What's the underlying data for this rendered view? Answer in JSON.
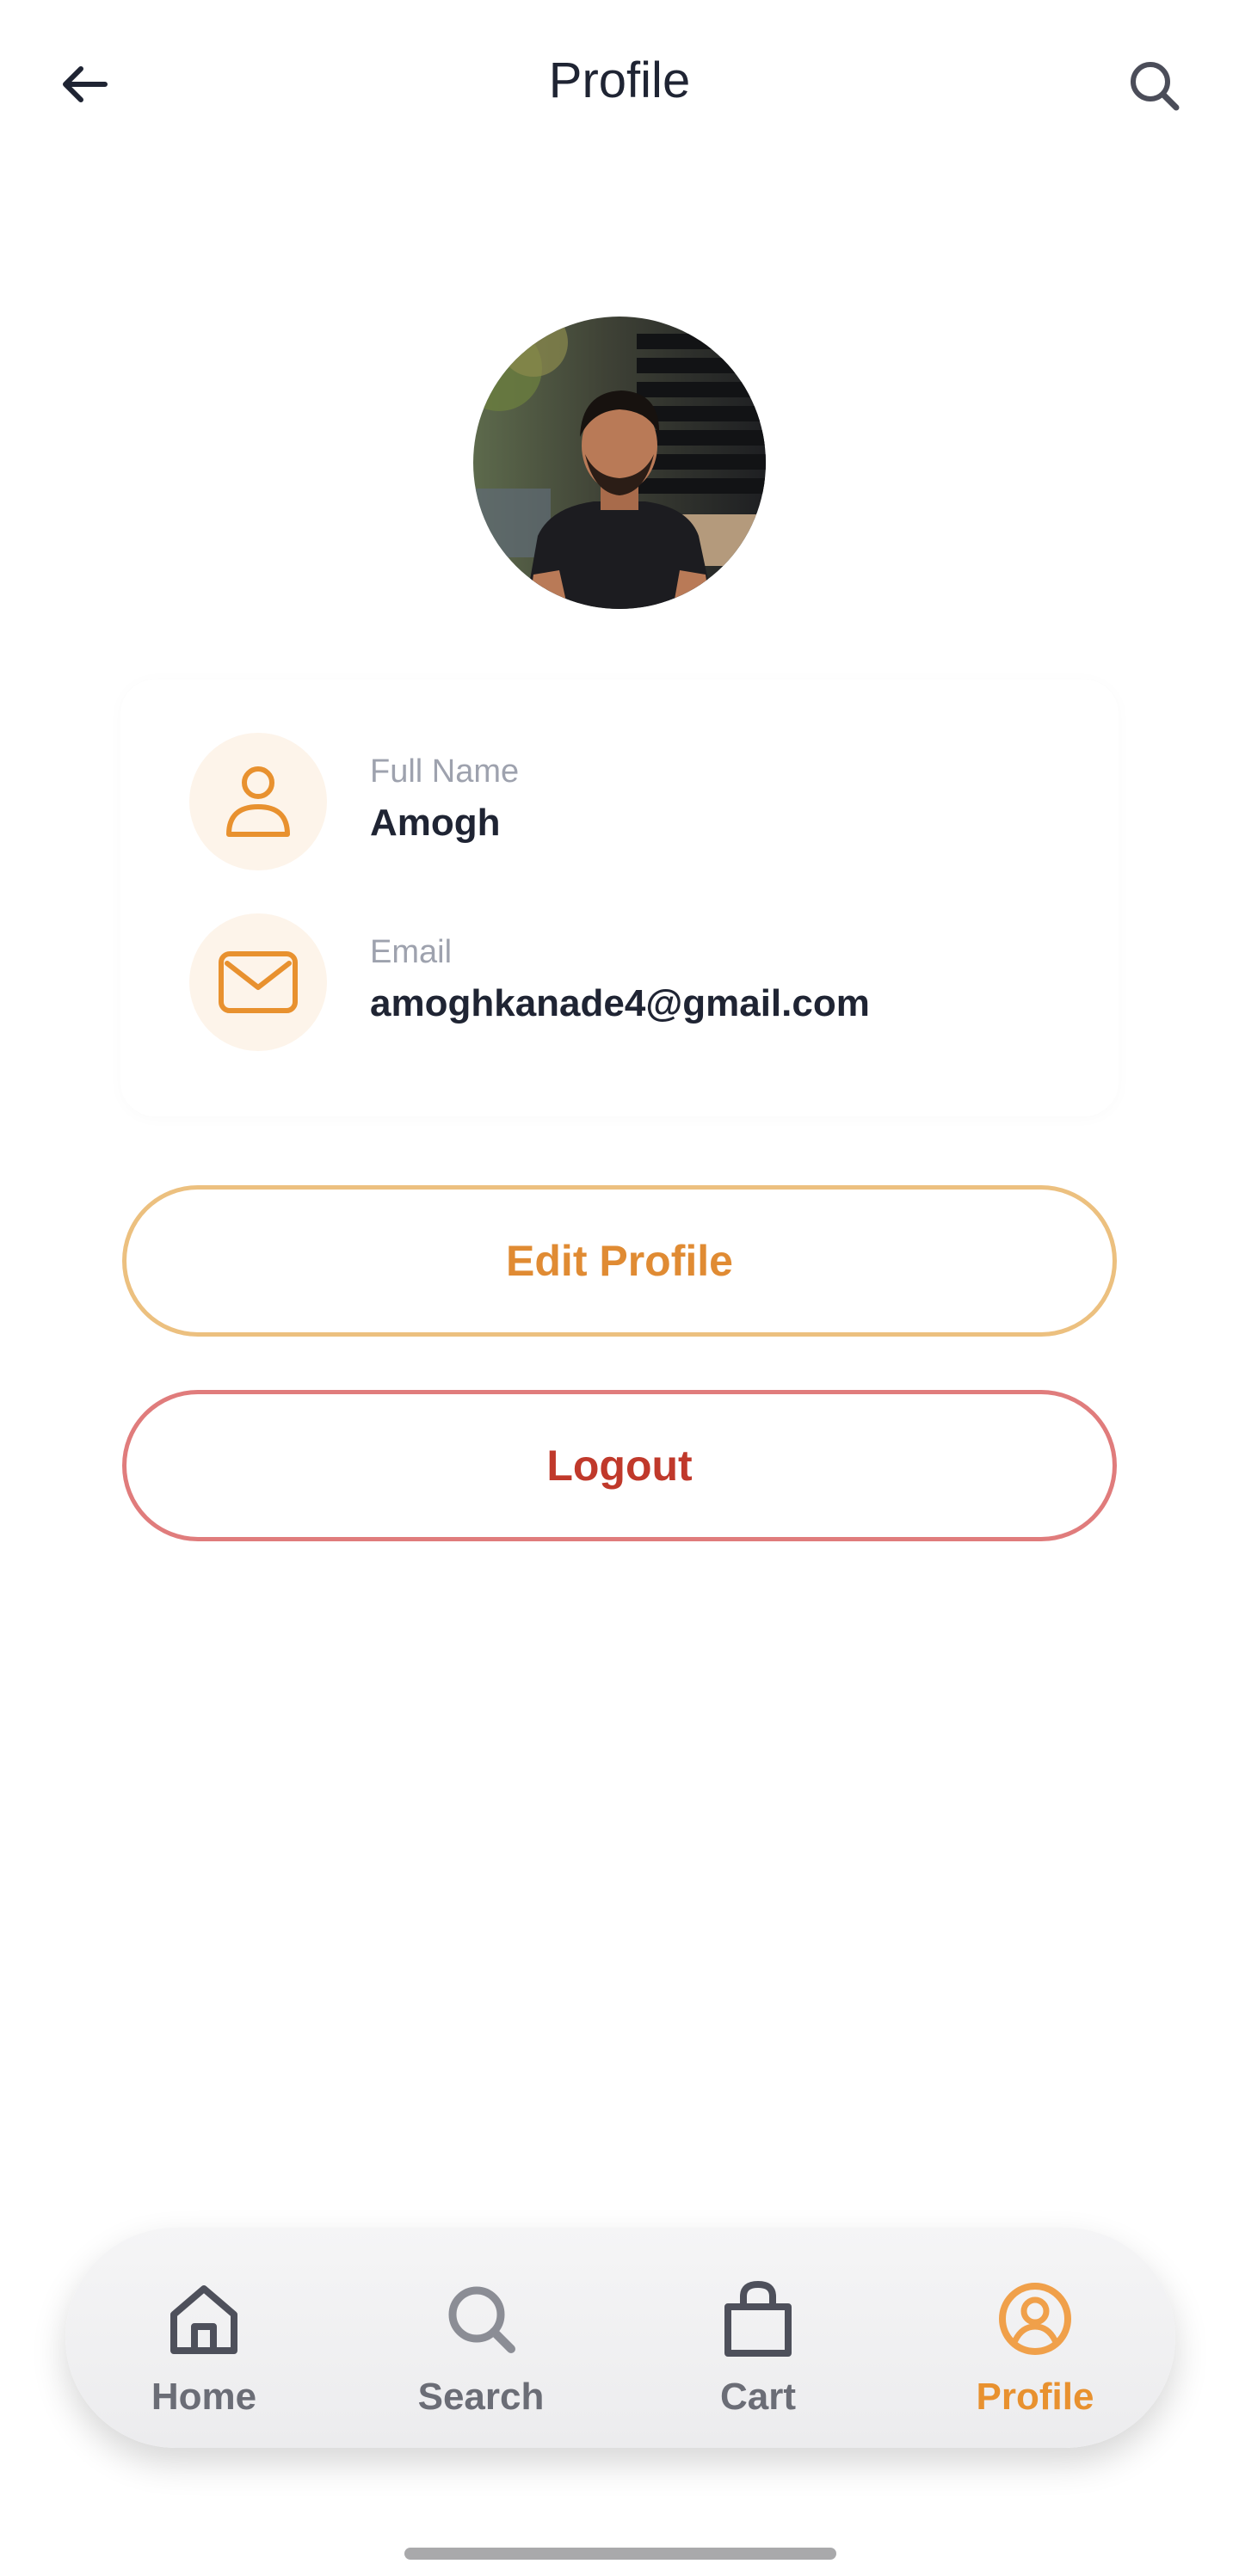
{
  "header": {
    "title": "Profile",
    "back_icon": "arrow-left-icon",
    "search_icon": "search-icon"
  },
  "profile": {
    "avatar": "profile-photo",
    "fields": [
      {
        "label": "Full Name",
        "value": "Amogh",
        "icon": "user-icon"
      },
      {
        "label": "Email",
        "value": "amoghkanade4@gmail.com",
        "icon": "mail-icon"
      }
    ]
  },
  "actions": {
    "edit_label": "Edit Profile",
    "logout_label": "Logout"
  },
  "nav": {
    "items": [
      {
        "label": "Home",
        "icon": "home-icon"
      },
      {
        "label": "Search",
        "icon": "search-icon"
      },
      {
        "label": "Cart",
        "icon": "shopping-bag-icon"
      },
      {
        "label": "Profile",
        "icon": "user-circle-icon",
        "active": true
      }
    ]
  },
  "colors": {
    "accent": "#e8912f",
    "danger": "#c0392b",
    "text": "#1f2433",
    "muted": "#9ea2ae"
  }
}
